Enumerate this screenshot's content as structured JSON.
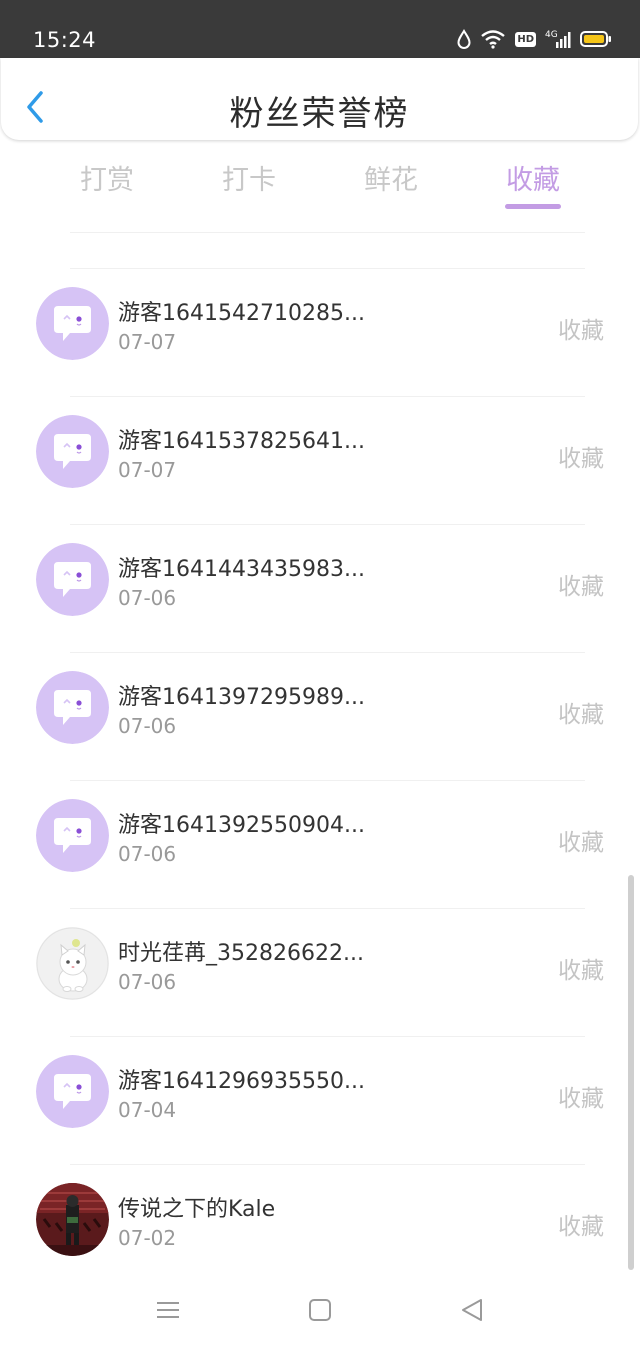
{
  "status_bar": {
    "time": "15:24",
    "network": "4G",
    "hd_label": "HD",
    "icons": [
      "water-drop-icon",
      "wifi-icon",
      "hd-icon",
      "signal-4g-icon",
      "battery-icon"
    ],
    "battery_color": "#f5c518"
  },
  "header": {
    "title": "粉丝荣誉榜",
    "back_icon": "chevron-left-icon",
    "back_color": "#2f9be8"
  },
  "tabs": [
    {
      "label": "打赏",
      "active": false
    },
    {
      "label": "打卡",
      "active": false
    },
    {
      "label": "鲜花",
      "active": false
    },
    {
      "label": "收藏",
      "active": true
    }
  ],
  "accent_color": "#c39ce4",
  "list": [
    {
      "name": "游客1641542710285...",
      "date": "07-07",
      "action": "收藏",
      "avatar": "chat-bubble-avatar"
    },
    {
      "name": "游客1641537825641...",
      "date": "07-07",
      "action": "收藏",
      "avatar": "chat-bubble-avatar"
    },
    {
      "name": "游客1641443435983...",
      "date": "07-06",
      "action": "收藏",
      "avatar": "chat-bubble-avatar"
    },
    {
      "name": "游客1641397295989...",
      "date": "07-06",
      "action": "收藏",
      "avatar": "chat-bubble-avatar"
    },
    {
      "name": "游客1641392550904...",
      "date": "07-06",
      "action": "收藏",
      "avatar": "chat-bubble-avatar"
    },
    {
      "name": "时光荏苒_352826622...",
      "date": "07-06",
      "action": "收藏",
      "avatar": "cat-photo-avatar"
    },
    {
      "name": "游客1641296935550...",
      "date": "07-04",
      "action": "收藏",
      "avatar": "chat-bubble-avatar"
    },
    {
      "name": "传说之下的Kale",
      "date": "07-02",
      "action": "收藏",
      "avatar": "character-photo-avatar"
    }
  ],
  "nav_bar": {
    "icons": [
      "menu-icon",
      "home-square-icon",
      "back-triangle-icon"
    ]
  }
}
